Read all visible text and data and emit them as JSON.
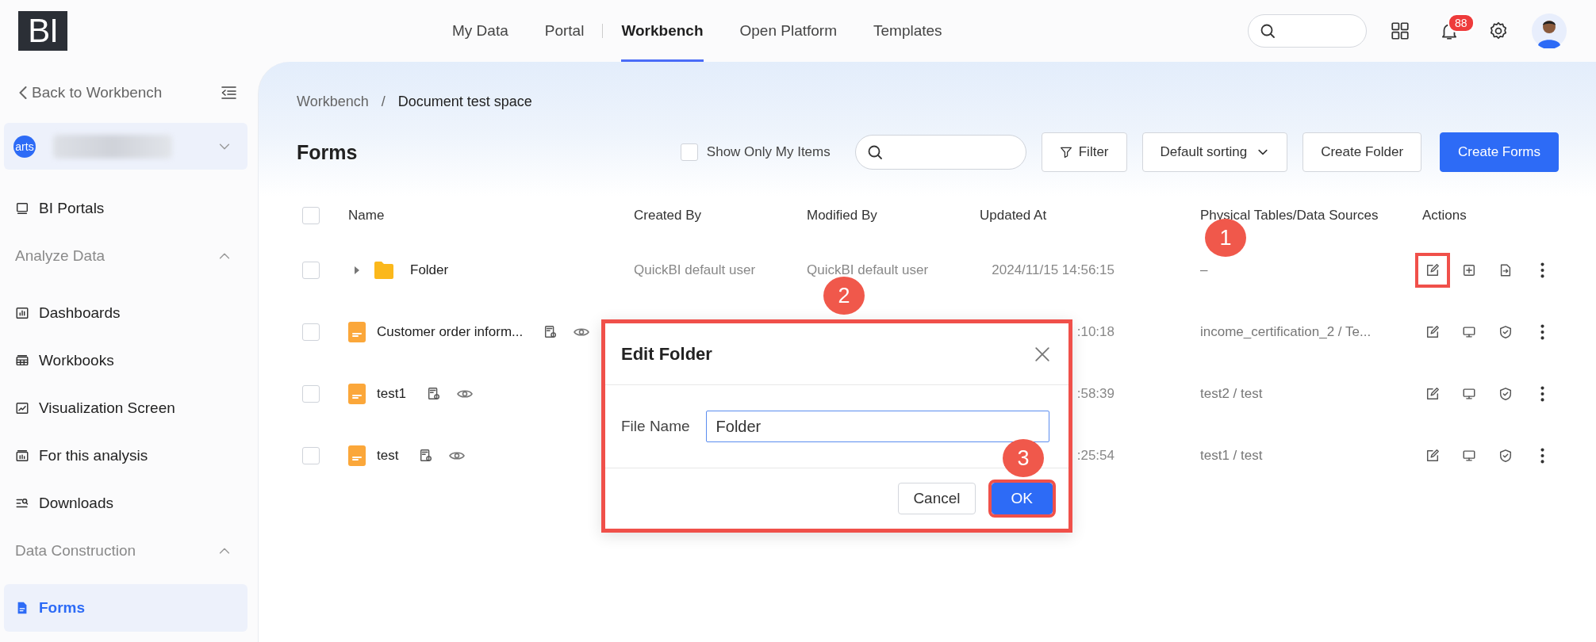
{
  "header": {
    "logo": "BI",
    "nav": [
      {
        "label": "My Data",
        "selected": false
      },
      {
        "label": "Portal",
        "selected": false
      },
      {
        "label": "Workbench",
        "selected": true
      },
      {
        "label": "Open Platform",
        "selected": false
      },
      {
        "label": "Templates",
        "selected": false
      }
    ],
    "notification_count": "88"
  },
  "sidebar": {
    "back": "Back to Workbench",
    "workspace": {
      "avatar_text": "arts"
    },
    "items": [
      {
        "kind": "item",
        "label": "BI Portals",
        "selected": false
      },
      {
        "kind": "section",
        "label": "Analyze Data",
        "expanded": true
      },
      {
        "kind": "item",
        "label": "Dashboards",
        "selected": false
      },
      {
        "kind": "item",
        "label": "Workbooks",
        "selected": false
      },
      {
        "kind": "item",
        "label": "Visualization Screen",
        "selected": false
      },
      {
        "kind": "item",
        "label": "For this analysis",
        "selected": false
      },
      {
        "kind": "item",
        "label": "Downloads",
        "selected": false
      },
      {
        "kind": "section",
        "label": "Data Construction",
        "expanded": true
      },
      {
        "kind": "item",
        "label": "Forms",
        "selected": true
      }
    ]
  },
  "breadcrumb": {
    "items": [
      "Workbench",
      "Document test space"
    ],
    "separator": "/"
  },
  "title": "Forms",
  "toolbar": {
    "show_only_mine": {
      "label": "Show Only My Items",
      "checked": false
    },
    "filter": "Filter",
    "sorting": "Default sorting",
    "create_folder": "Create Folder",
    "create_forms": "Create Forms"
  },
  "table": {
    "select_all_checked": false,
    "columns": [
      "Name",
      "Created By",
      "Modified By",
      "Updated At",
      "Physical Tables/Data Sources",
      "Actions"
    ],
    "rows": [
      {
        "kind": "folder",
        "checked": false,
        "name": "Folder",
        "created_by": "QuickBI default user",
        "modified_by": "QuickBI default user",
        "updated_at": "2024/11/15 14:56:15",
        "source": "–",
        "actions": [
          {
            "kind": "edit",
            "highlighted": true
          },
          {
            "kind": "add",
            "highlighted": false
          },
          {
            "kind": "export",
            "highlighted": false
          },
          {
            "kind": "more",
            "highlighted": false
          }
        ]
      },
      {
        "kind": "form",
        "checked": false,
        "name": "Customer order inform...",
        "updated_at": ":10:18",
        "source": "income_certification_2 / Te...",
        "actions": [
          {
            "kind": "edit",
            "highlighted": false
          },
          {
            "kind": "monitor",
            "highlighted": false
          },
          {
            "kind": "shield",
            "highlighted": false
          },
          {
            "kind": "more",
            "highlighted": false
          }
        ]
      },
      {
        "kind": "form",
        "checked": false,
        "name": "test1",
        "updated_at": ":58:39",
        "source": "test2 / test",
        "actions": [
          {
            "kind": "edit",
            "highlighted": false
          },
          {
            "kind": "monitor",
            "highlighted": false
          },
          {
            "kind": "shield",
            "highlighted": false
          },
          {
            "kind": "more",
            "highlighted": false
          }
        ]
      },
      {
        "kind": "form",
        "checked": false,
        "name": "test",
        "updated_at": ":25:54",
        "source": "test1 / test",
        "actions": [
          {
            "kind": "edit",
            "highlighted": false
          },
          {
            "kind": "monitor",
            "highlighted": false
          },
          {
            "kind": "shield",
            "highlighted": false
          },
          {
            "kind": "more",
            "highlighted": false
          }
        ]
      }
    ]
  },
  "dialog": {
    "title": "Edit Folder",
    "highlighted": true,
    "field_label": "File Name",
    "value": "Folder",
    "cancel": "Cancel",
    "ok": {
      "label": "OK",
      "highlighted": true
    }
  },
  "step_markers": [
    {
      "label": "1"
    },
    {
      "label": "2"
    },
    {
      "label": "3"
    }
  ]
}
